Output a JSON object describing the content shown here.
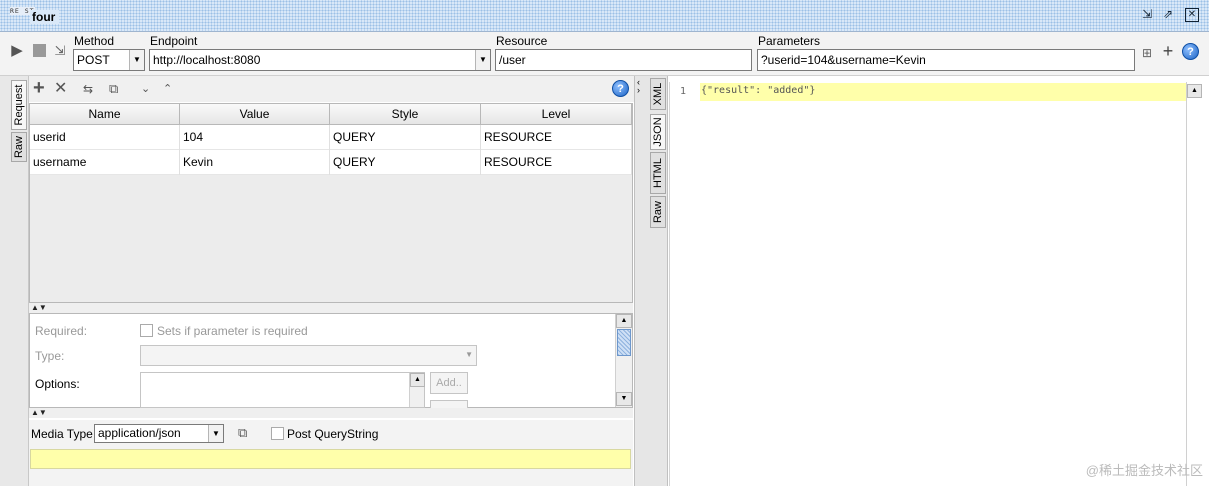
{
  "window": {
    "logo": "RE ST",
    "title": "four"
  },
  "toolbar": {
    "method_label": "Method",
    "method_value": "POST",
    "endpoint_label": "Endpoint",
    "endpoint_value": "http://localhost:8080",
    "resource_label": "Resource",
    "resource_value": "/user",
    "parameters_label": "Parameters",
    "parameters_value": "?userid=104&username=Kevin",
    "help": "?"
  },
  "left_tabs": [
    "Request",
    "Raw"
  ],
  "params_table": {
    "headers": [
      "Name",
      "Value",
      "Style",
      "Level"
    ],
    "rows": [
      [
        "userid",
        "104",
        "QUERY",
        "RESOURCE"
      ],
      [
        "username",
        "Kevin",
        "QUERY",
        "RESOURCE"
      ]
    ]
  },
  "props": {
    "required_label": "Required:",
    "required_checkbox": "Sets if parameter is required",
    "type_label": "Type:",
    "options_label": "Options:",
    "add_button": "Add.."
  },
  "media": {
    "label": "Media Type",
    "value": "application/json",
    "post_qs_label": "Post QueryString"
  },
  "response_tabs": [
    "XML",
    "JSON",
    "HTML",
    "Raw"
  ],
  "response": {
    "line_number": "1",
    "code": "{\"result\": \"added\"}"
  },
  "watermark": "@稀土掘金技术社区"
}
